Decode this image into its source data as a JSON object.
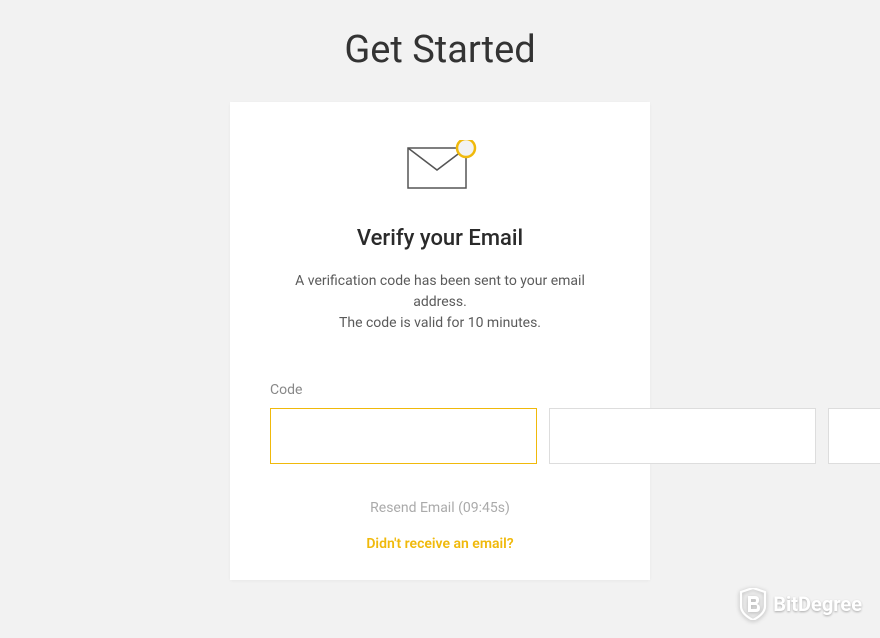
{
  "page": {
    "title": "Get Started"
  },
  "card": {
    "heading": "Verify your Email",
    "desc_line1": "A verification code has been sent to your email address.",
    "desc_line2": "The code is valid for 10 minutes.",
    "code_label": "Code",
    "resend_text": "Resend Email (09:45s)",
    "didnt_receive": "Didn't receive an email?"
  },
  "watermark": {
    "text": "BitDegree"
  },
  "colors": {
    "accent": "#f0b90b",
    "bg": "#f2f2f2"
  }
}
